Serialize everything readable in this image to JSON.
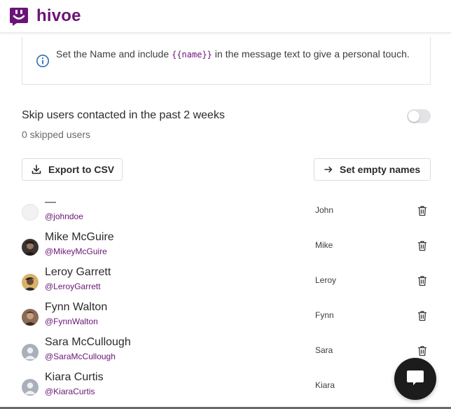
{
  "app": {
    "brand": "hivoe",
    "brand_color": "#6b1477"
  },
  "info": {
    "text_before": "Set the Name and include",
    "code": "{{name}}",
    "text_after": "in the message text to give a personal touch.",
    "icon": "info-icon"
  },
  "skip": {
    "label": "Skip users contacted in the past 2 weeks",
    "count_text": "0 skipped users",
    "enabled": false
  },
  "actions": {
    "export_label": "Export to CSV",
    "export_icon": "download-icon",
    "set_names_label": "Set empty names",
    "set_names_icon": "arrow-right-icon"
  },
  "users": [
    {
      "name": "—",
      "handle": "@johndoe",
      "first_name": "John",
      "avatar": "empty"
    },
    {
      "name": "Mike McGuire",
      "handle": "@MikeyMcGuire",
      "first_name": "Mike",
      "avatar": "photo"
    },
    {
      "name": "Leroy Garrett",
      "handle": "@LeroyGarrett",
      "first_name": "Leroy",
      "avatar": "photo"
    },
    {
      "name": "Fynn Walton",
      "handle": "@FynnWalton",
      "first_name": "Fynn",
      "avatar": "photo"
    },
    {
      "name": "Sara McCullough",
      "handle": "@SaraMcCullough",
      "first_name": "Sara",
      "avatar": "placeholder"
    },
    {
      "name": "Kiara Curtis",
      "handle": "@KiaraCurtis",
      "first_name": "Kiara",
      "avatar": "placeholder"
    }
  ],
  "chat": {
    "icon": "chat-icon"
  }
}
